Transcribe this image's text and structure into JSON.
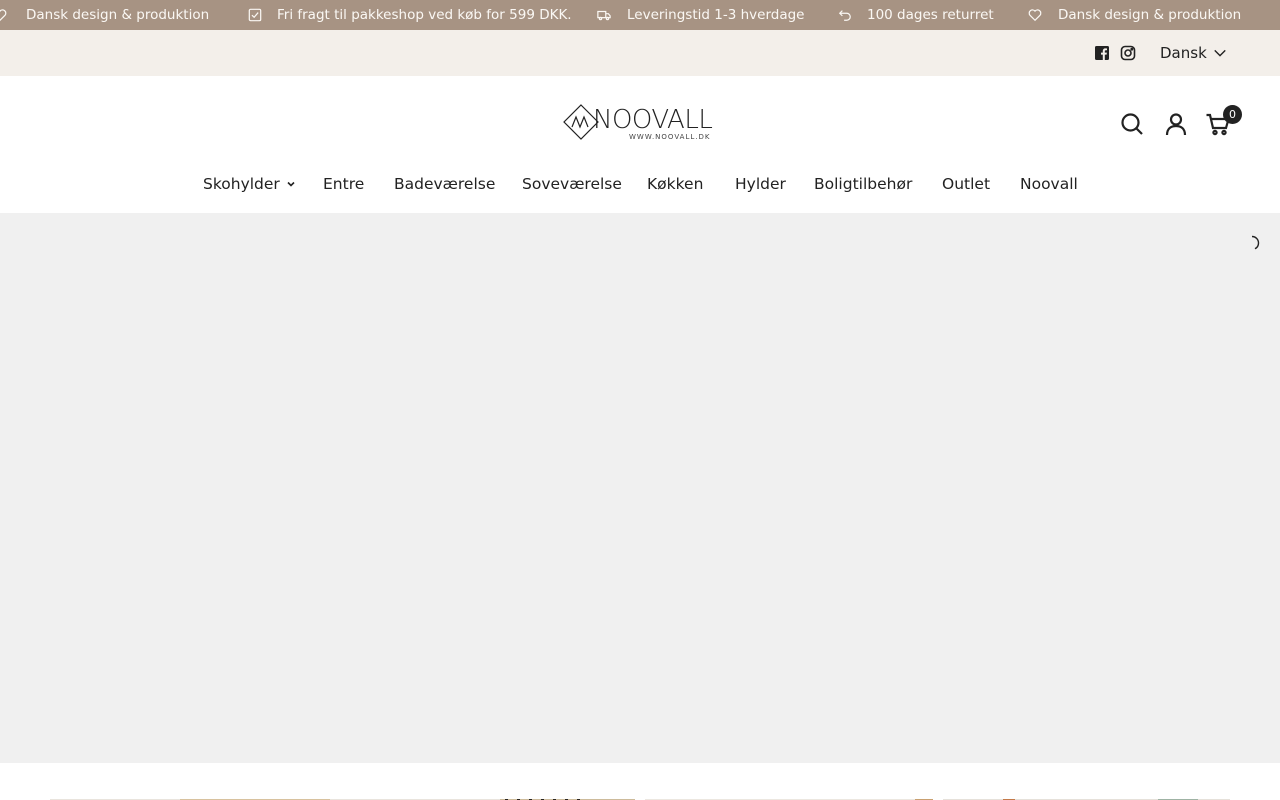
{
  "announcement": {
    "items": [
      {
        "text": "Dansk design & produktion",
        "icon": "heart-icon"
      },
      {
        "text": "Fri fragt til pakkeshop ved køb for 599 DKK.",
        "icon": "checkbox-icon"
      },
      {
        "text": "Leveringstid 1-3 hverdage",
        "icon": "truck-icon"
      },
      {
        "text": "100 dages returret",
        "icon": "return-arrow-icon"
      },
      {
        "text": "Dansk design & produktion",
        "icon": "heart-icon"
      }
    ],
    "bg_color": "#a79383"
  },
  "utility": {
    "social": [
      "facebook-icon",
      "instagram-icon"
    ],
    "language": "Dansk"
  },
  "header": {
    "logo_text": "NOOVALL",
    "logo_sub": "WWW.NOOVALL.DK",
    "cart_count": "0",
    "icons": [
      "search-icon",
      "account-icon",
      "cart-icon"
    ]
  },
  "nav": {
    "items": [
      {
        "label": "Skohylder",
        "has_dropdown": true
      },
      {
        "label": "Entre"
      },
      {
        "label": "Badeværelse"
      },
      {
        "label": "Soveværelse"
      },
      {
        "label": "Køkken"
      },
      {
        "label": "Hylder"
      },
      {
        "label": "Boligtilbehør"
      },
      {
        "label": "Outlet"
      },
      {
        "label": "Noovall"
      }
    ]
  },
  "hero": {
    "state": "loading",
    "bg_color": "#f0f0f0"
  }
}
